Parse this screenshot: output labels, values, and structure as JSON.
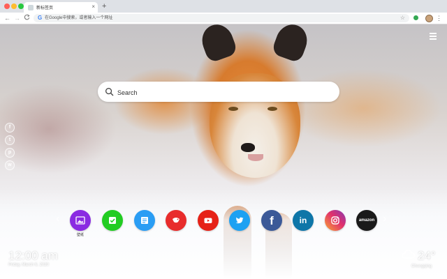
{
  "browser": {
    "tab_title": "新标签页",
    "tab_close": "×",
    "new_tab": "+",
    "omnibox_placeholder": "在Google中搜索，或者输入一个网址",
    "nav_back": "←",
    "nav_forward": "→",
    "nav_reload": "C",
    "bookmark_star": "☆",
    "menu": "⋮",
    "google_g": "G"
  },
  "search": {
    "placeholder": "Search"
  },
  "social_links": [
    {
      "icon": "facebook-icon",
      "glyph": "f"
    },
    {
      "icon": "twitter-icon",
      "glyph": "t"
    },
    {
      "icon": "pinterest-icon",
      "glyph": "p"
    },
    {
      "icon": "wechat-icon",
      "glyph": "w"
    }
  ],
  "apps": [
    {
      "name": "wallpaper",
      "label": "壁纸",
      "color": "#8a2be2",
      "icon": "image-icon"
    },
    {
      "name": "tasks",
      "label": "",
      "color": "#22cc22",
      "icon": "checklist-icon"
    },
    {
      "name": "notes",
      "label": "",
      "color": "#2a9df4",
      "icon": "note-icon"
    },
    {
      "name": "games",
      "label": "",
      "color": "#e82c2c",
      "icon": "gamepad-icon"
    },
    {
      "name": "youtube",
      "label": "",
      "color": "#e62117",
      "icon": "youtube-icon"
    },
    {
      "name": "twitter",
      "label": "",
      "color": "#1da1f2",
      "icon": "twitter-icon"
    },
    {
      "name": "facebook",
      "label": "",
      "color": "#3b5998",
      "icon": "facebook-icon"
    },
    {
      "name": "linkedin",
      "label": "",
      "color": "#0e76a8",
      "icon": "linkedin-icon"
    },
    {
      "name": "instagram",
      "label": "",
      "color": "#e1306c",
      "icon": "instagram-icon"
    },
    {
      "name": "amazon",
      "label": "",
      "color": "#1a1a1a",
      "icon": "amazon-icon"
    }
  ],
  "app_glyphs": {
    "facebook": "f",
    "linkedin": "in",
    "amazon": "amazon"
  },
  "carousel": {
    "prev": "‹",
    "next": "›"
  },
  "clock": {
    "time": "12:00 am",
    "date": "Friday, March 6, 2020"
  },
  "weather": {
    "temperature": "24°",
    "city": "Chongqing",
    "condition_icon": "cloud-icon"
  },
  "colors": {
    "fox_orange": "#d77b2e",
    "search_bg": "#ffffff",
    "chrome_bg": "#dee1e6"
  }
}
